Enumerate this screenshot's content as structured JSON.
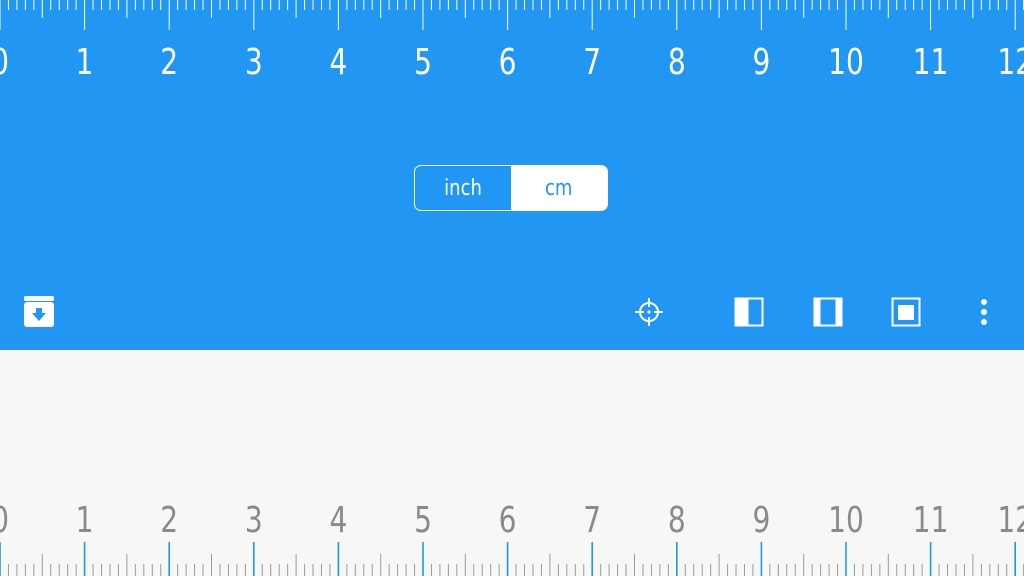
{
  "ruler": {
    "unit": "cm",
    "labels": [
      "0",
      "1",
      "2",
      "3",
      "4",
      "5",
      "6",
      "7",
      "8",
      "9",
      "10",
      "11",
      "12"
    ]
  },
  "unit_toggle": {
    "options": [
      "inch",
      "cm"
    ],
    "selected": "cm"
  },
  "toolbar": {
    "left": [
      "save-icon"
    ],
    "right": [
      "crosshair-icon",
      "layout-left-icon",
      "layout-center-icon",
      "layout-full-icon",
      "more-vertical-icon"
    ]
  },
  "colors": {
    "primary": "#2196f3",
    "surface": "#f7f7f7",
    "ruler_text_light": "#ffffff",
    "ruler_text_dark": "#8a8a8a",
    "ruler_accent_tick": "#2196f3"
  }
}
